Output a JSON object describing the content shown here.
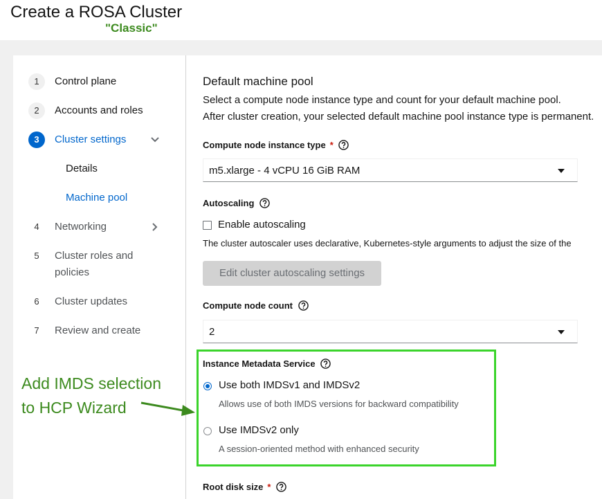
{
  "header": {
    "title": "Create a ROSA Cluster",
    "annotation_classic": "\"Classic\""
  },
  "nav": {
    "steps": [
      {
        "num": "1",
        "label": "Control plane"
      },
      {
        "num": "2",
        "label": "Accounts and roles"
      },
      {
        "num": "3",
        "label": "Cluster settings"
      },
      {
        "num": "4",
        "label": "Networking"
      },
      {
        "num": "5",
        "label": "Cluster roles and",
        "label2": "policies"
      },
      {
        "num": "6",
        "label": "Cluster updates"
      },
      {
        "num": "7",
        "label": "Review and create"
      }
    ],
    "substeps": [
      {
        "label": "Details"
      },
      {
        "label": "Machine pool"
      }
    ]
  },
  "main": {
    "heading": "Default machine pool",
    "desc_line1": "Select a compute node instance type and count for your default machine pool.",
    "desc_line2": "After cluster creation, your selected default machine pool instance type is permanent.",
    "instance_type": {
      "label": "Compute node instance type",
      "required": "*",
      "value": "m5.xlarge - 4 vCPU 16 GiB RAM"
    },
    "autoscaling": {
      "label": "Autoscaling",
      "checkbox_label": "Enable autoscaling",
      "checked": false,
      "helper": "The cluster autoscaler uses declarative, Kubernetes-style arguments to adjust the size of the",
      "button": "Edit cluster autoscaling settings"
    },
    "node_count": {
      "label": "Compute node count",
      "value": "2"
    },
    "imds": {
      "label": "Instance Metadata Service",
      "options": [
        {
          "label": "Use both IMDSv1 and IMDSv2",
          "description": "Allows use of both IMDS versions for backward compatibility",
          "selected": true
        },
        {
          "label": "Use IMDSv2 only",
          "description": "A session-oriented method with enhanced security",
          "selected": false
        }
      ]
    },
    "root_disk": {
      "label": "Root disk size",
      "required": "*"
    }
  },
  "annotation": {
    "line1": "Add IMDS selection",
    "line2": "to HCP Wizard",
    "color": "#3c8a1e",
    "box_color": "#3bd42b"
  },
  "colors": {
    "accent": "#0066cc",
    "required": "#c9190b",
    "background_band": "#f0f0f0"
  }
}
